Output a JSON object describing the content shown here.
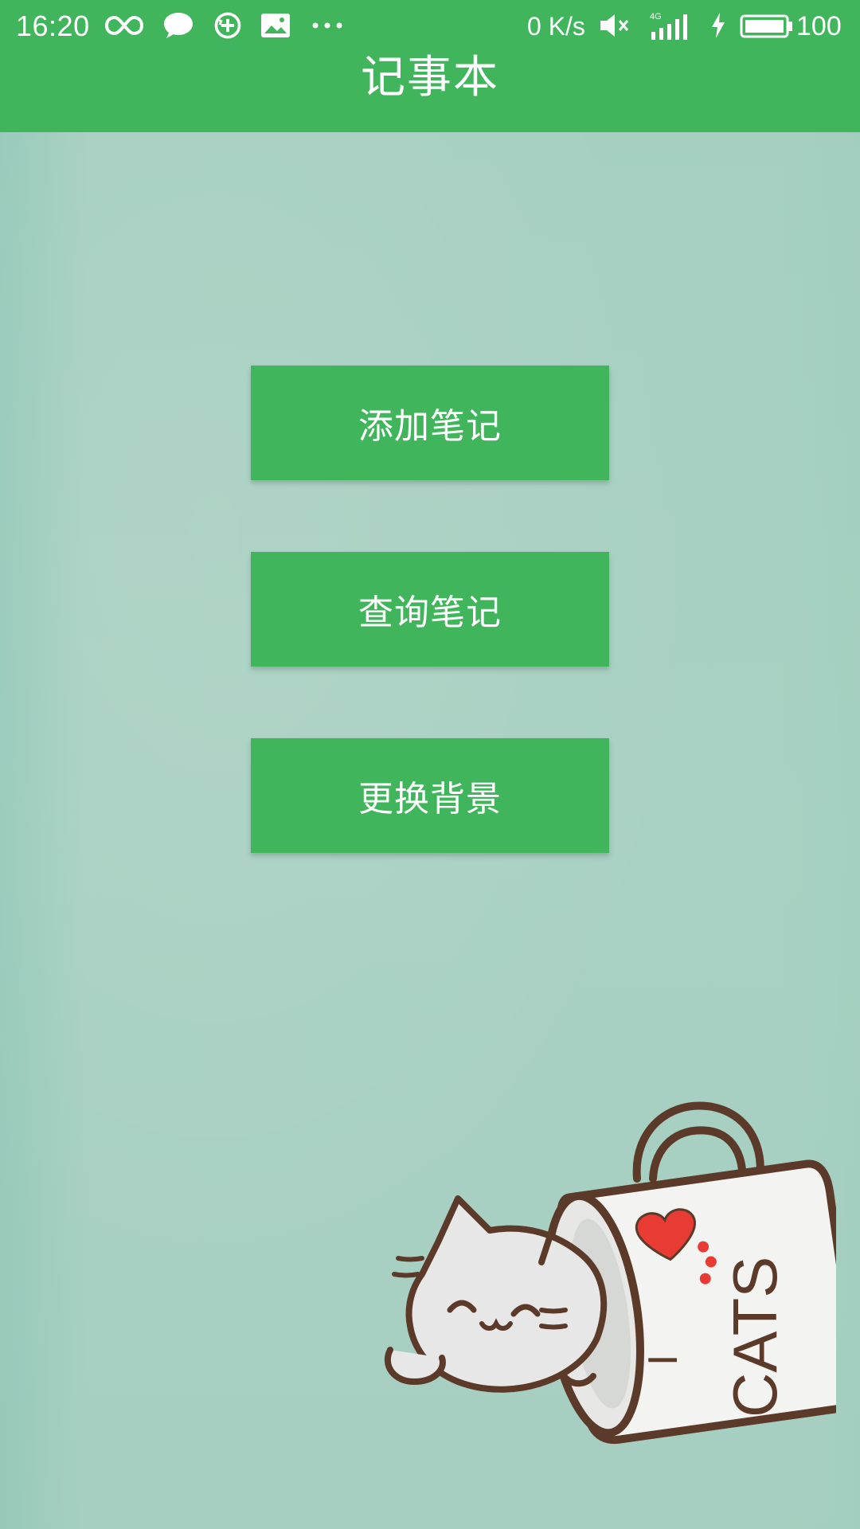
{
  "status_bar": {
    "time": "16:20",
    "net_speed": "0 K/s",
    "network": "4G",
    "battery": "100",
    "icons": [
      "infinity-icon",
      "chat-bubble-icon",
      "sync-plus-icon",
      "image-icon",
      "more-dots-icon",
      "mute-icon",
      "signal-icon",
      "charging-icon",
      "battery-icon"
    ]
  },
  "app_bar": {
    "title": "记事本"
  },
  "buttons": {
    "add_note": "添加笔记",
    "query_note": "查询笔记",
    "change_background": "更换背景"
  },
  "illustration": {
    "mug_text_line1": "I",
    "mug_text_line2": "CATS"
  },
  "colors": {
    "primary": "#40b55c",
    "background": "#a9d1c3",
    "text_on_primary": "#ffffff"
  }
}
